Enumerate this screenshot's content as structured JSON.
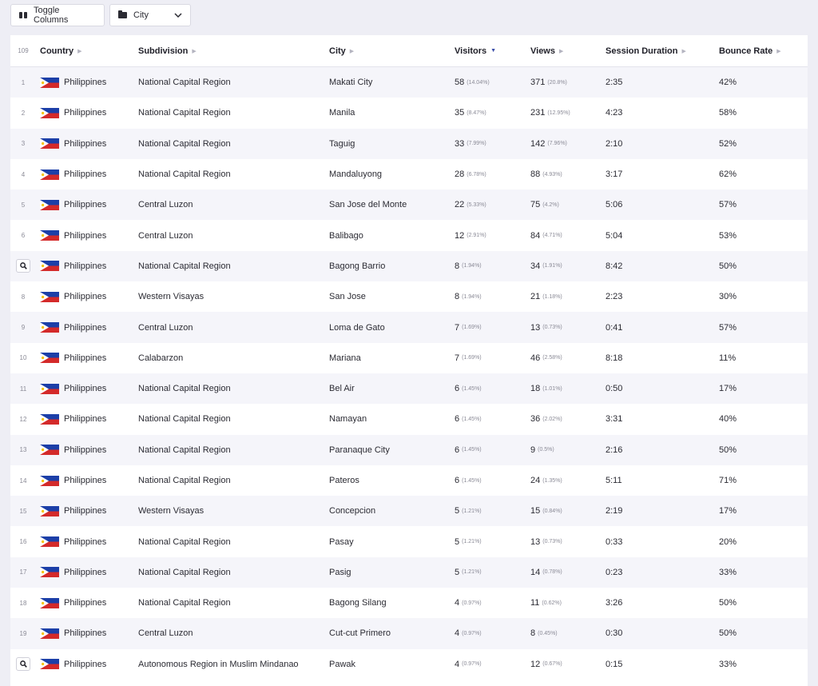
{
  "toolbar": {
    "toggle_label": "Toggle Columns",
    "dimension_value": "City"
  },
  "table": {
    "total": "109",
    "headers": {
      "country": "Country",
      "subdivision": "Subdivision",
      "city": "City",
      "visitors": "Visitors",
      "views": "Views",
      "duration": "Session Duration",
      "bounce": "Bounce Rate"
    },
    "sorted_by": "visitors",
    "rows": [
      {
        "idx": "1",
        "country": "Philippines",
        "subdivision": "National Capital Region",
        "city": "Makati City",
        "visitors": "58",
        "visitors_pct": "(14.04%)",
        "views": "371",
        "views_pct": "(20.8%)",
        "duration": "2:35",
        "bounce": "42%"
      },
      {
        "idx": "2",
        "country": "Philippines",
        "subdivision": "National Capital Region",
        "city": "Manila",
        "visitors": "35",
        "visitors_pct": "(8.47%)",
        "views": "231",
        "views_pct": "(12.95%)",
        "duration": "4:23",
        "bounce": "58%"
      },
      {
        "idx": "3",
        "country": "Philippines",
        "subdivision": "National Capital Region",
        "city": "Taguig",
        "visitors": "33",
        "visitors_pct": "(7.99%)",
        "views": "142",
        "views_pct": "(7.96%)",
        "duration": "2:10",
        "bounce": "52%"
      },
      {
        "idx": "4",
        "country": "Philippines",
        "subdivision": "National Capital Region",
        "city": "Mandaluyong",
        "visitors": "28",
        "visitors_pct": "(6.78%)",
        "views": "88",
        "views_pct": "(4.93%)",
        "duration": "3:17",
        "bounce": "62%"
      },
      {
        "idx": "5",
        "country": "Philippines",
        "subdivision": "Central Luzon",
        "city": "San Jose del Monte",
        "visitors": "22",
        "visitors_pct": "(5.33%)",
        "views": "75",
        "views_pct": "(4.2%)",
        "duration": "5:06",
        "bounce": "57%"
      },
      {
        "idx": "6",
        "country": "Philippines",
        "subdivision": "Central Luzon",
        "city": "Balibago",
        "visitors": "12",
        "visitors_pct": "(2.91%)",
        "views": "84",
        "views_pct": "(4.71%)",
        "duration": "5:04",
        "bounce": "53%"
      },
      {
        "idx": "",
        "magnifier": true,
        "country": "Philippines",
        "subdivision": "National Capital Region",
        "city": "Bagong Barrio",
        "visitors": "8",
        "visitors_pct": "(1.94%)",
        "views": "34",
        "views_pct": "(1.91%)",
        "duration": "8:42",
        "bounce": "50%"
      },
      {
        "idx": "8",
        "country": "Philippines",
        "subdivision": "Western Visayas",
        "city": "San Jose",
        "visitors": "8",
        "visitors_pct": "(1.94%)",
        "views": "21",
        "views_pct": "(1.18%)",
        "duration": "2:23",
        "bounce": "30%"
      },
      {
        "idx": "9",
        "country": "Philippines",
        "subdivision": "Central Luzon",
        "city": "Loma de Gato",
        "visitors": "7",
        "visitors_pct": "(1.69%)",
        "views": "13",
        "views_pct": "(0.73%)",
        "duration": "0:41",
        "bounce": "57%"
      },
      {
        "idx": "10",
        "country": "Philippines",
        "subdivision": "Calabarzon",
        "city": "Mariana",
        "visitors": "7",
        "visitors_pct": "(1.69%)",
        "views": "46",
        "views_pct": "(2.58%)",
        "duration": "8:18",
        "bounce": "11%"
      },
      {
        "idx": "11",
        "country": "Philippines",
        "subdivision": "National Capital Region",
        "city": "Bel Air",
        "visitors": "6",
        "visitors_pct": "(1.45%)",
        "views": "18",
        "views_pct": "(1.01%)",
        "duration": "0:50",
        "bounce": "17%"
      },
      {
        "idx": "12",
        "country": "Philippines",
        "subdivision": "National Capital Region",
        "city": "Namayan",
        "visitors": "6",
        "visitors_pct": "(1.45%)",
        "views": "36",
        "views_pct": "(2.02%)",
        "duration": "3:31",
        "bounce": "40%"
      },
      {
        "idx": "13",
        "country": "Philippines",
        "subdivision": "National Capital Region",
        "city": "Paranaque City",
        "visitors": "6",
        "visitors_pct": "(1.45%)",
        "views": "9",
        "views_pct": "(0.5%)",
        "duration": "2:16",
        "bounce": "50%"
      },
      {
        "idx": "14",
        "country": "Philippines",
        "subdivision": "National Capital Region",
        "city": "Pateros",
        "visitors": "6",
        "visitors_pct": "(1.45%)",
        "views": "24",
        "views_pct": "(1.35%)",
        "duration": "5:11",
        "bounce": "71%"
      },
      {
        "idx": "15",
        "country": "Philippines",
        "subdivision": "Western Visayas",
        "city": "Concepcion",
        "visitors": "5",
        "visitors_pct": "(1.21%)",
        "views": "15",
        "views_pct": "(0.84%)",
        "duration": "2:19",
        "bounce": "17%"
      },
      {
        "idx": "16",
        "country": "Philippines",
        "subdivision": "National Capital Region",
        "city": "Pasay",
        "visitors": "5",
        "visitors_pct": "(1.21%)",
        "views": "13",
        "views_pct": "(0.73%)",
        "duration": "0:33",
        "bounce": "20%"
      },
      {
        "idx": "17",
        "country": "Philippines",
        "subdivision": "National Capital Region",
        "city": "Pasig",
        "visitors": "5",
        "visitors_pct": "(1.21%)",
        "views": "14",
        "views_pct": "(0.78%)",
        "duration": "0:23",
        "bounce": "33%"
      },
      {
        "idx": "18",
        "country": "Philippines",
        "subdivision": "National Capital Region",
        "city": "Bagong Silang",
        "visitors": "4",
        "visitors_pct": "(0.97%)",
        "views": "11",
        "views_pct": "(0.62%)",
        "duration": "3:26",
        "bounce": "50%"
      },
      {
        "idx": "19",
        "country": "Philippines",
        "subdivision": "Central Luzon",
        "city": "Cut-cut Primero",
        "visitors": "4",
        "visitors_pct": "(0.97%)",
        "views": "8",
        "views_pct": "(0.45%)",
        "duration": "0:30",
        "bounce": "50%"
      },
      {
        "idx": "",
        "magnifier": true,
        "country": "Philippines",
        "subdivision": "Autonomous Region in Muslim Mindanao",
        "city": "Pawak",
        "visitors": "4",
        "visitors_pct": "(0.97%)",
        "views": "12",
        "views_pct": "(0.67%)",
        "duration": "0:15",
        "bounce": "33%"
      }
    ]
  },
  "icons": {
    "toggle": "columns-icon",
    "dimension": "folder-icon",
    "dropdown": "chevron-down-icon",
    "flag": "philippines-flag-icon",
    "row_action": "magnifier-icon",
    "sort_inactive": "triangle-right-icon",
    "sort_active": "triangle-down-icon"
  },
  "colors": {
    "background": "#eeeef5",
    "row_alt": "#f5f5fa",
    "flag_blue": "#1c3fa8",
    "flag_red": "#d42a2a",
    "flag_yellow": "#f5c400",
    "sort_active": "#3b4ea8"
  }
}
